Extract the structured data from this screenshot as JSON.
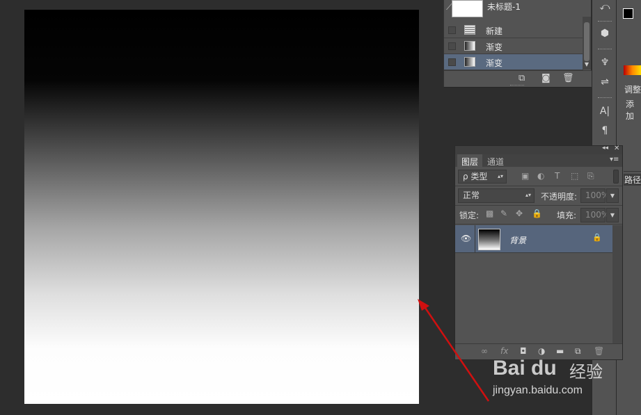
{
  "history_panel": {
    "snapshot_title": "未标题-1",
    "items": [
      {
        "label": "新建",
        "icon": "document-icon",
        "selected": false
      },
      {
        "label": "渐变",
        "icon": "gradient-icon",
        "selected": false
      },
      {
        "label": "渐变",
        "icon": "gradient-icon",
        "selected": true
      }
    ]
  },
  "right_panel": {
    "adjust_label": "调整",
    "add_label": "添加",
    "paths_tab": "路径"
  },
  "layers_panel": {
    "tabs": [
      "图层",
      "通道"
    ],
    "filter_kind": "ρ 类型",
    "blend_mode": "正常",
    "opacity_label": "不透明度:",
    "opacity_value": "100%",
    "lock_label": "锁定:",
    "fill_label": "填充:",
    "fill_value": "100%",
    "layers": [
      {
        "name": "背景",
        "visible": true,
        "locked": true,
        "selected": true
      }
    ]
  },
  "watermark": {
    "brand": "Bai du",
    "suffix": "经验",
    "url": "jingyan.baidu.com"
  },
  "colors": {
    "panel_bg": "#535353",
    "workspace_bg": "#2d2d2d",
    "selection": "#56657c",
    "annotation_arrow": "#d01010"
  }
}
